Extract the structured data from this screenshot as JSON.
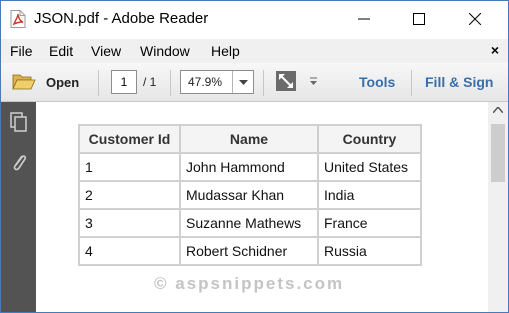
{
  "window": {
    "title": "JSON.pdf - Adobe Reader"
  },
  "menu": [
    "File",
    "Edit",
    "View",
    "Window",
    "Help"
  ],
  "menu_close_glyph": "×",
  "toolbar": {
    "open_label": "Open",
    "page_current": "1",
    "page_total": "/ 1",
    "zoom": "47.9%",
    "tools_label": "Tools",
    "fill_sign_label": "Fill & Sign"
  },
  "table": {
    "headers": [
      "Customer Id",
      "Name",
      "Country"
    ],
    "rows": [
      [
        "1",
        "John Hammond",
        "United States"
      ],
      [
        "2",
        "Mudassar Khan",
        "India"
      ],
      [
        "3",
        "Suzanne Mathews",
        "France"
      ],
      [
        "4",
        "Robert Schidner",
        "Russia"
      ]
    ]
  },
  "watermark": "© aspsnippets.com",
  "colors": {
    "link": "#3a6ea8",
    "rail": "#535353",
    "accent_border": "#4a7ab5"
  },
  "icons": [
    "pdf-file-icon",
    "minimize-icon",
    "maximize-icon",
    "close-icon",
    "folder-open-icon",
    "dropdown-arrow-icon",
    "expand-icon",
    "more-icon",
    "page-thumbnails-icon",
    "attachment-icon",
    "scroll-up-arrow-icon"
  ]
}
